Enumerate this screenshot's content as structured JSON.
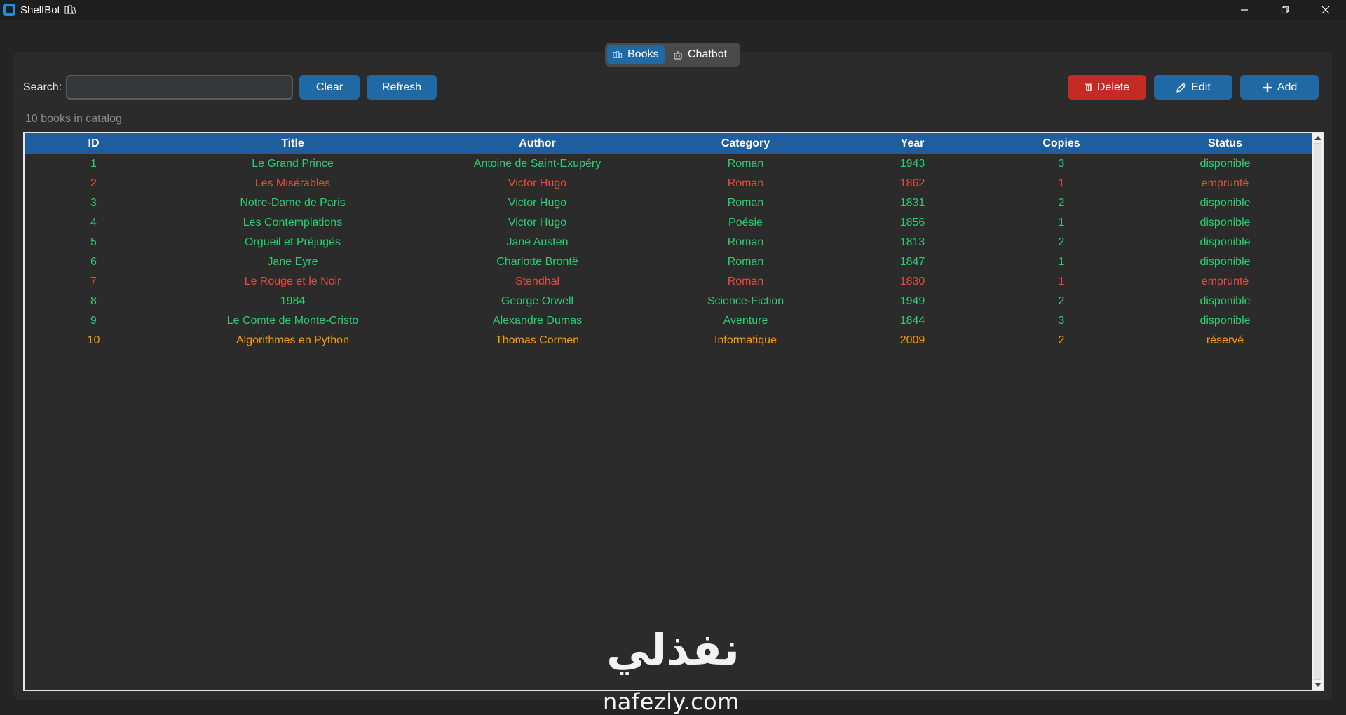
{
  "window": {
    "title": "ShelfBot"
  },
  "tabs": [
    {
      "label": "Books",
      "active": true,
      "icon": "books-icon"
    },
    {
      "label": "Chatbot",
      "active": false,
      "icon": "robot-icon"
    }
  ],
  "toolbar": {
    "search_label": "Search:",
    "search_value": "",
    "clear_label": "Clear",
    "refresh_label": "Refresh",
    "delete_label": "Delete",
    "edit_label": "Edit",
    "add_label": "Add"
  },
  "catalog": {
    "count_text": "10 books in catalog"
  },
  "table": {
    "columns": [
      "ID",
      "Title",
      "Author",
      "Category",
      "Year",
      "Copies",
      "Status"
    ],
    "rows": [
      {
        "id": "1",
        "title": "Le Grand Prince",
        "author": "Antoine de Saint-Exupéry",
        "category": "Roman",
        "year": "1943",
        "copies": "3",
        "status": "disponible"
      },
      {
        "id": "2",
        "title": "Les Misérables",
        "author": "Victor Hugo",
        "category": "Roman",
        "year": "1862",
        "copies": "1",
        "status": "emprunté"
      },
      {
        "id": "3",
        "title": "Notre-Dame de Paris",
        "author": "Victor Hugo",
        "category": "Roman",
        "year": "1831",
        "copies": "2",
        "status": "disponible"
      },
      {
        "id": "4",
        "title": "Les Contemplations",
        "author": "Victor Hugo",
        "category": "Poésie",
        "year": "1856",
        "copies": "1",
        "status": "disponible"
      },
      {
        "id": "5",
        "title": "Orgueil et Préjugés",
        "author": "Jane Austen",
        "category": "Roman",
        "year": "1813",
        "copies": "2",
        "status": "disponible"
      },
      {
        "id": "6",
        "title": "Jane Eyre",
        "author": "Charlotte Brontë",
        "category": "Roman",
        "year": "1847",
        "copies": "1",
        "status": "disponible"
      },
      {
        "id": "7",
        "title": "Le Rouge et le Noir",
        "author": "Stendhal",
        "category": "Roman",
        "year": "1830",
        "copies": "1",
        "status": "emprunté"
      },
      {
        "id": "8",
        "title": "1984",
        "author": "George Orwell",
        "category": "Science-Fiction",
        "year": "1949",
        "copies": "2",
        "status": "disponible"
      },
      {
        "id": "9",
        "title": "Le Comte de Monte-Cristo",
        "author": "Alexandre Dumas",
        "category": "Aventure",
        "year": "1844",
        "copies": "3",
        "status": "disponible"
      },
      {
        "id": "10",
        "title": "Algorithmes en Python",
        "author": "Thomas Cormen",
        "category": "Informatique",
        "year": "2009",
        "copies": "2",
        "status": "réservé"
      }
    ]
  },
  "status_colors": {
    "disponible": "#2ecc71",
    "emprunté": "#e74c3c",
    "réservé": "#f39c12"
  },
  "watermark": {
    "arabic": "نفذلي",
    "latin": "nafezly.com"
  }
}
